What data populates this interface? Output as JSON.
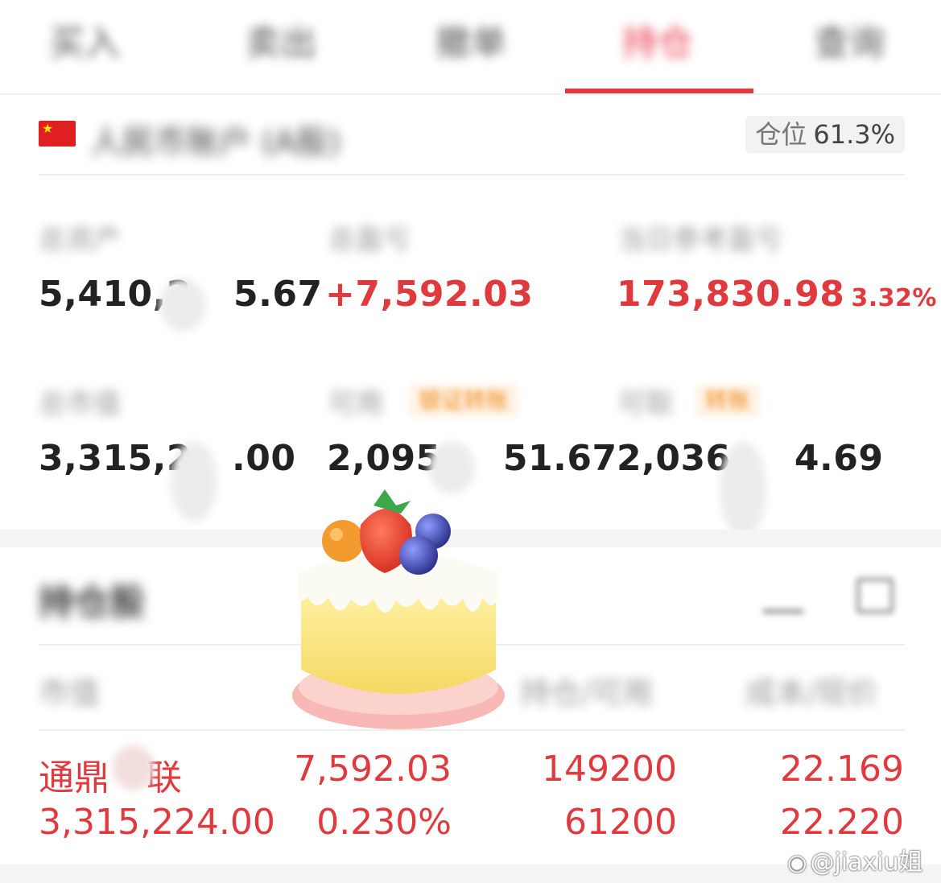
{
  "tabs": [
    {
      "label": "买入",
      "active": false
    },
    {
      "label": "卖出",
      "active": false
    },
    {
      "label": "撤单",
      "active": false
    },
    {
      "label": "持仓",
      "active": true
    },
    {
      "label": "查询",
      "active": false
    }
  ],
  "account": {
    "name": "人民币账户 (A股)",
    "position_label": "仓位",
    "position_value": "61.3%"
  },
  "stats": {
    "total_assets_label": "总资产",
    "total_assets_value": "5,410,2",
    "total_assets_tail": "5.67",
    "total_pl_label": "总盈亏",
    "total_pl_value": "+7,592.03",
    "today_pl_label": "当日参考盈亏",
    "today_pl_value": "173,830.98",
    "today_pl_pct": "3.32%",
    "market_value_label": "总市值",
    "market_value_value": "3,315,2",
    "market_value_tail": ".00",
    "available_label": "可用",
    "available_chip": "银证转账",
    "available_value": "2,095,",
    "available_tail": "51.67",
    "withdrawable_label": "可取",
    "withdrawable_chip": "转账",
    "withdrawable_value": "2,036,",
    "withdrawable_tail": "4.69"
  },
  "holdings": {
    "title": "持仓股",
    "headers": [
      "市值",
      "持仓/可用",
      "成本/现价"
    ],
    "rows": [
      {
        "name_prefix": "通鼎",
        "name_suffix": "联",
        "market_value": "3,315,224.00",
        "pl": "7,592.03",
        "pl_pct": "0.230%",
        "holding": "149200",
        "available": "61200",
        "cost": "22.169",
        "price": "22.220"
      }
    ]
  },
  "watermark": "@jiaxiu姐",
  "colors": {
    "accent_red": "#e03a3e",
    "chip_orange": "#f0891a",
    "muted_text": "#999999"
  }
}
